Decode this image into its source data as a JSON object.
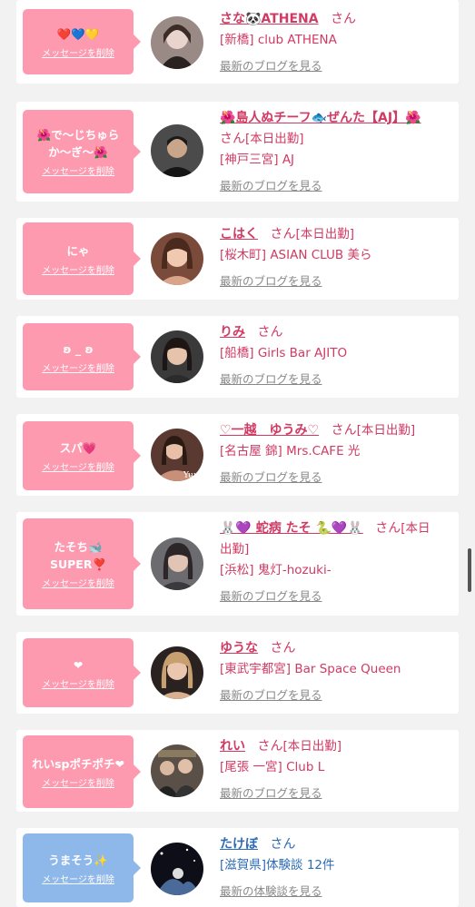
{
  "cards": [
    {
      "theme": "pink",
      "message": "❤️💙💛",
      "delete_label": "メッセージを削除",
      "name": "さな🐼ATHENA",
      "suffix": "さん",
      "status": "",
      "name_line2": "",
      "shop": "[新橋] club ATHENA",
      "link": "最新のブログを見る"
    },
    {
      "theme": "pink",
      "message": "🌺で〜じちゅらか〜ぎ〜🌺",
      "delete_label": "メッセージを削除",
      "name": "🌺島人ぬチーフ🐟ぜんた【AJ】🌺",
      "suffix": "さん",
      "status": "[本日出勤]",
      "name_line2": "",
      "shop": "[神戸三宮] AJ",
      "link": "最新のブログを見る"
    },
    {
      "theme": "pink",
      "message": "にゃ",
      "delete_label": "メッセージを削除",
      "name": "こはく",
      "suffix": "さん",
      "status": "[本日出勤]",
      "name_line2": "",
      "shop": "[桜木町] ASIAN CLUB 美ら",
      "link": "最新のブログを見る"
    },
    {
      "theme": "pink",
      "message": "ʚ _ ʚ",
      "delete_label": "メッセージを削除",
      "name": "りみ",
      "suffix": "さん",
      "status": "",
      "name_line2": "",
      "shop": "[船橋] Girls Bar AJITO",
      "link": "最新のブログを見る"
    },
    {
      "theme": "pink",
      "message": "スパ💗",
      "delete_label": "メッセージを削除",
      "name": "♡一越　ゆうみ♡",
      "suffix": "さん",
      "status": "[本日出勤]",
      "name_line2": "",
      "shop": "[名古屋 錦] Mrs.CAFE 光",
      "link": "最新のブログを見る"
    },
    {
      "theme": "pink",
      "message": "たそち🐋SUPER❣️",
      "delete_label": "メッセージを削除",
      "name": "🐰💜 蛇病 たそ 🐍💜🐰",
      "suffix": "さん",
      "status": "[本日",
      "name_line2": "出勤]",
      "shop": "[浜松] 鬼灯-hozuki-",
      "link": "最新のブログを見る"
    },
    {
      "theme": "pink",
      "message": "❤",
      "delete_label": "メッセージを削除",
      "name": "ゆうな",
      "suffix": "さん",
      "status": "",
      "name_line2": "",
      "shop": "[東武宇都宮] Bar Space Queen",
      "link": "最新のブログを見る"
    },
    {
      "theme": "pink",
      "message": "れいspポチポチ❤",
      "delete_label": "メッセージを削除",
      "name": "れい",
      "suffix": "さん",
      "status": "[本日出勤]",
      "name_line2": "",
      "shop": "[尾張 一宮] Club L",
      "link": "最新のブログを見る"
    },
    {
      "theme": "blue",
      "message": "うまそう✨",
      "delete_label": "メッセージを削除",
      "name": "たけぼ",
      "suffix": "さん",
      "status": "",
      "name_line2": "",
      "shop": "[滋賀県]体験談 12件",
      "link": "最新の体験談を見る"
    }
  ],
  "colors": {
    "pink_bubble": "#fd9ab0",
    "blue_bubble": "#8fb8ea",
    "name_pink": "#d03a63",
    "name_blue": "#2d6bb4"
  }
}
